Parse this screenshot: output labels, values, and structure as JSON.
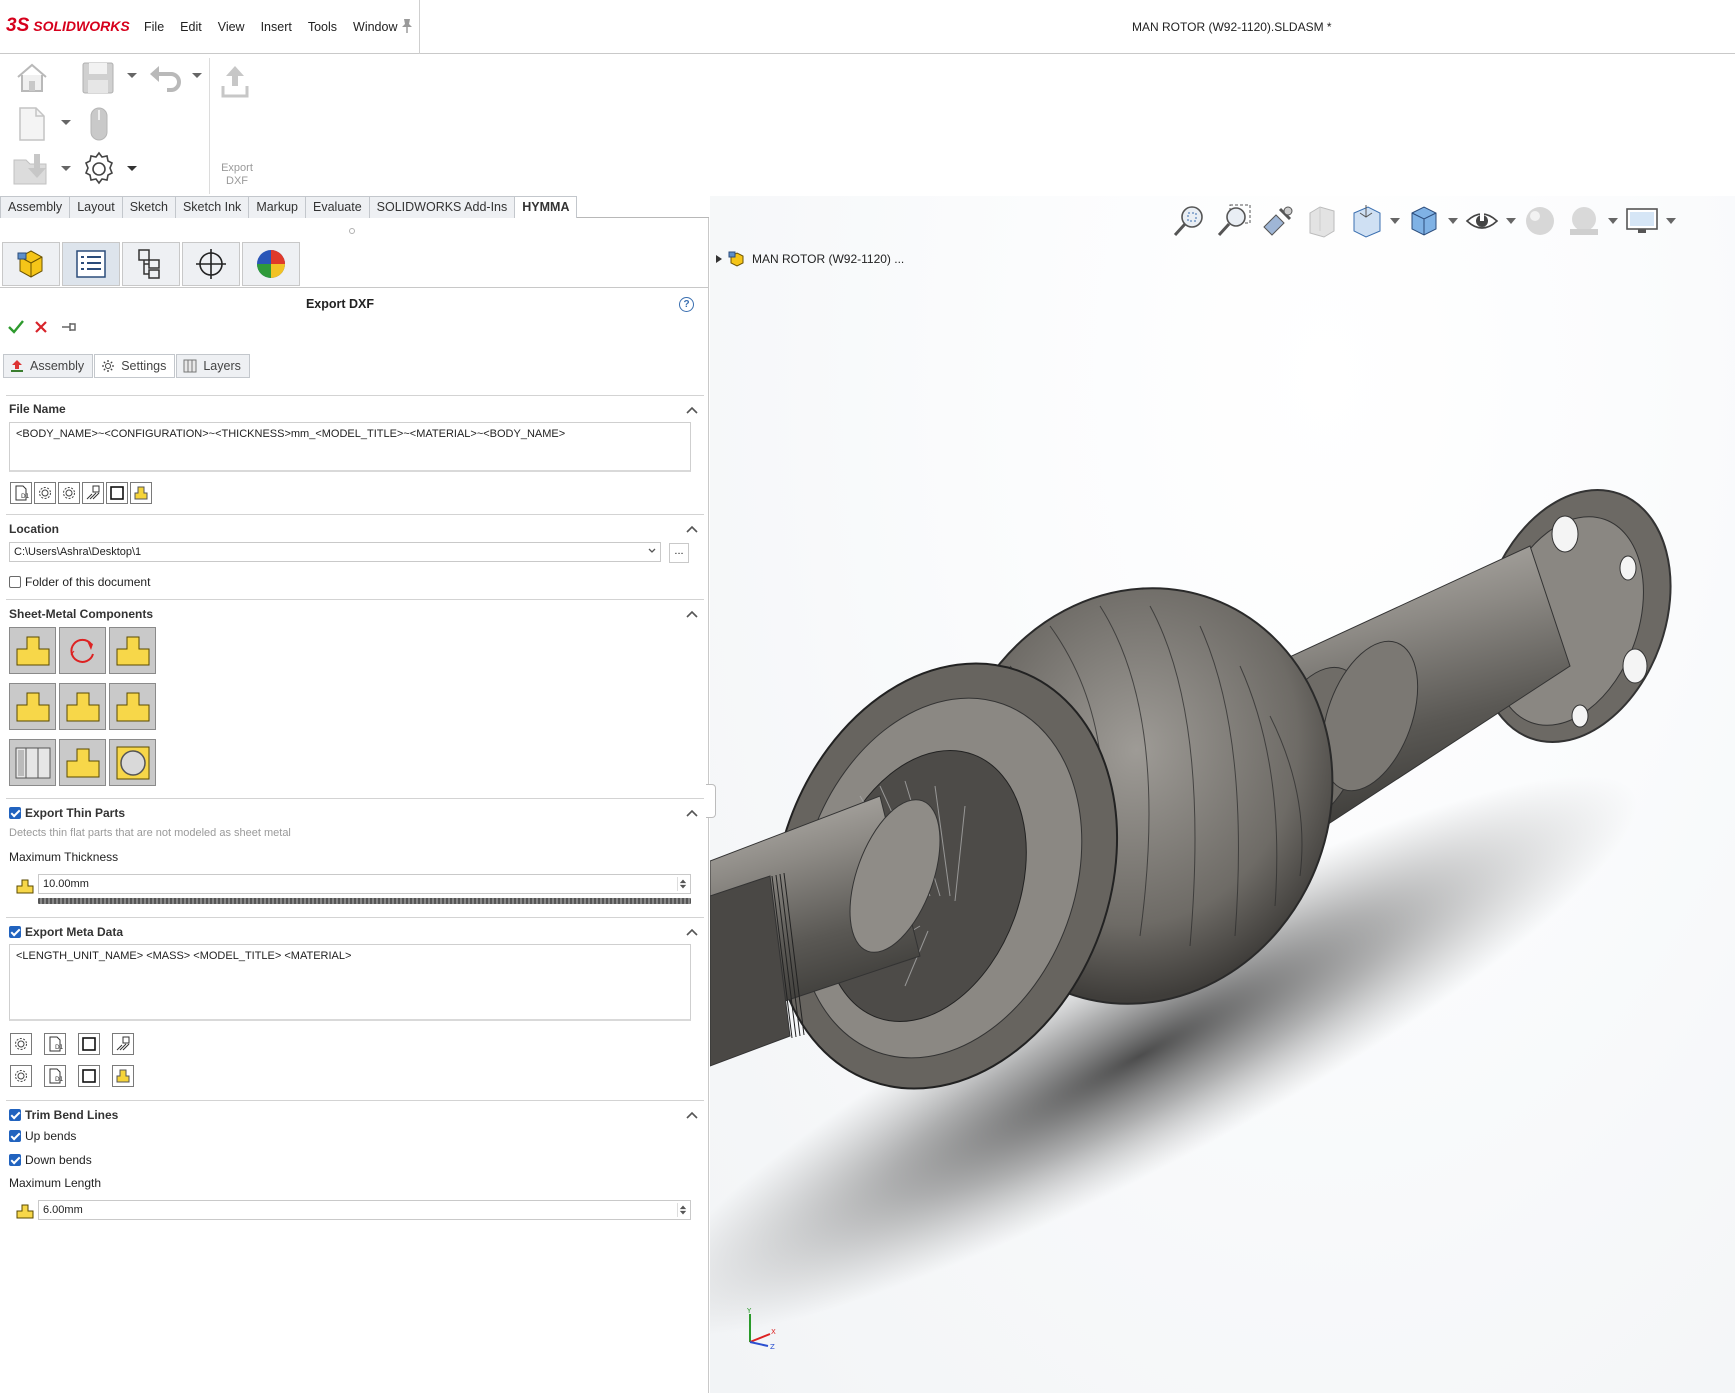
{
  "app": {
    "brand_ds": "3S",
    "brand_name": "SOLIDWORKS",
    "brand_color": "#d6001c",
    "document_title": "MAN ROTOR (W92-1120).SLDASM *"
  },
  "menu": {
    "items": [
      "File",
      "Edit",
      "View",
      "Insert",
      "Tools",
      "Window"
    ]
  },
  "toolbar": {
    "export_dxf_label": "Export DXF",
    "icons": [
      "home-icon",
      "save-icon",
      "undo-icon",
      "new-document-icon",
      "mouse-icon",
      "open-icon",
      "options-gear-icon",
      "export-dxf-icon"
    ]
  },
  "command_tabs": {
    "items": [
      "Assembly",
      "Layout",
      "Sketch",
      "Sketch Ink",
      "Markup",
      "Evaluate",
      "SOLIDWORKS Add-Ins",
      "HYMMA"
    ],
    "active": "HYMMA"
  },
  "manager_tabs": [
    "assembly-tree-icon",
    "property-manager-icon",
    "configuration-manager-icon",
    "dimxpert-icon",
    "display-manager-icon"
  ],
  "property_manager": {
    "title": "Export DXF",
    "tabs": [
      {
        "label": "Assembly",
        "icon": "export-arrow-icon"
      },
      {
        "label": "Settings",
        "icon": "gear-icon"
      },
      {
        "label": "Layers",
        "icon": "layers-icon"
      }
    ],
    "active_tab": "Settings",
    "file_name": {
      "heading": "File Name",
      "value": "<BODY_NAME>~<CONFIGURATION>~<THICKNESS>mm_<MODEL_TITLE>~<MATERIAL>~<BODY_NAME>"
    },
    "location": {
      "heading": "Location",
      "value": "C:\\Users\\Ashra\\Desktop\\1",
      "browse_label": "...",
      "folder_of_document_label": "Folder of this document",
      "folder_of_document_checked": false
    },
    "sheet_metal": {
      "heading": "Sheet-Metal Components"
    },
    "thin_parts": {
      "heading": "Export Thin Parts",
      "checked": true,
      "description": "Detects thin flat parts that are not modeled as sheet metal",
      "max_thickness_label": "Maximum Thickness",
      "max_thickness_value": "10.00mm"
    },
    "meta_data": {
      "heading": "Export Meta Data",
      "checked": true,
      "value": "<LENGTH_UNIT_NAME> <MASS> <MODEL_TITLE> <MATERIAL>"
    },
    "trim_bend": {
      "heading": "Trim Bend Lines",
      "checked": true,
      "up_label": "Up bends",
      "up_checked": true,
      "down_label": "Down bends",
      "down_checked": true,
      "max_length_label": "Maximum Length",
      "max_length_value": "6.00mm"
    }
  },
  "viewport": {
    "tree_root": "MAN ROTOR (W92-1120) ...",
    "heads_up_icons": [
      "zoom-to-fit-icon",
      "zoom-to-area-icon",
      "previous-view-icon",
      "section-view-icon",
      "view-orientation-icon",
      "display-style-icon",
      "hide-show-items-icon",
      "edit-appearance-icon",
      "apply-scene-icon",
      "view-settings-icon"
    ],
    "triad_axes": [
      "Y",
      "X",
      "Z"
    ]
  }
}
